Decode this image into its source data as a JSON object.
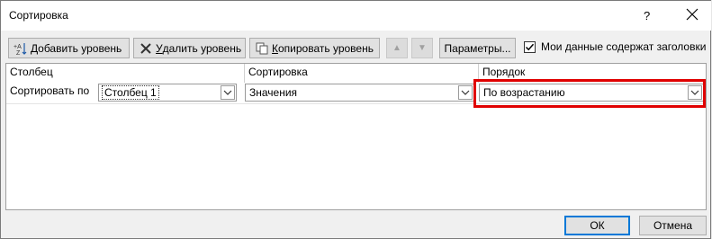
{
  "window": {
    "title": "Сортировка",
    "help_glyph": "?"
  },
  "toolbar": {
    "add_level_prefix": "",
    "add_level_hotkey": "Д",
    "add_level_rest": "обавить уровень",
    "delete_level_hotkey": "У",
    "delete_level_rest": "далить уровень",
    "copy_level_hotkey": "К",
    "copy_level_rest": "опировать уровень",
    "options_label": "Параметры...",
    "headers_checkbox_label": "Мои данные содержат заголовки",
    "headers_checked": true
  },
  "grid": {
    "columns": [
      "Столбец",
      "Сортировка",
      "Порядок"
    ],
    "rows": [
      {
        "label": "Сортировать по",
        "column": "Столбец 1",
        "sort_on": "Значения",
        "order": "По возрастанию"
      }
    ]
  },
  "footer": {
    "ok_label": "ОК",
    "cancel_label": "Отмена"
  },
  "colors": {
    "highlight": "#e00000",
    "default_button_border": "#0078d7"
  }
}
